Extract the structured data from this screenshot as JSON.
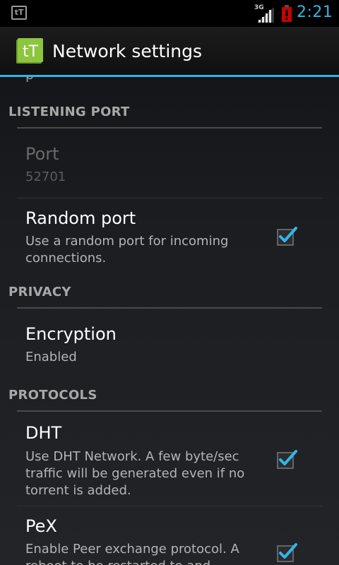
{
  "status_bar": {
    "notification_label": "tT",
    "network_type": "3G",
    "clock": "2:21"
  },
  "action_bar": {
    "app_icon_label": "tT",
    "title": "Network settings"
  },
  "list": {
    "partial_text": "p",
    "sections": [
      {
        "title": "LISTENING PORT"
      },
      {
        "title": "PRIVACY"
      },
      {
        "title": "PROTOCOLS"
      }
    ],
    "items": [
      {
        "title": "Port",
        "summary": "52701",
        "enabled": false
      },
      {
        "title": "Random port",
        "summary": "Use a random port for incoming connections.",
        "checked": true
      },
      {
        "title": "Encryption",
        "summary": "Enabled"
      },
      {
        "title": "DHT",
        "summary": "Use DHT Network. A few byte/sec traffic will be generated even if no torrent is added.",
        "checked": true
      },
      {
        "title": "PeX",
        "summary": "Enable Peer exchange protocol. A reboot to be restarted to and",
        "checked": true
      }
    ]
  },
  "colors": {
    "accent": "#33b5e5",
    "app_icon": "#8cc63f",
    "battery_alert": "#cc0000"
  }
}
